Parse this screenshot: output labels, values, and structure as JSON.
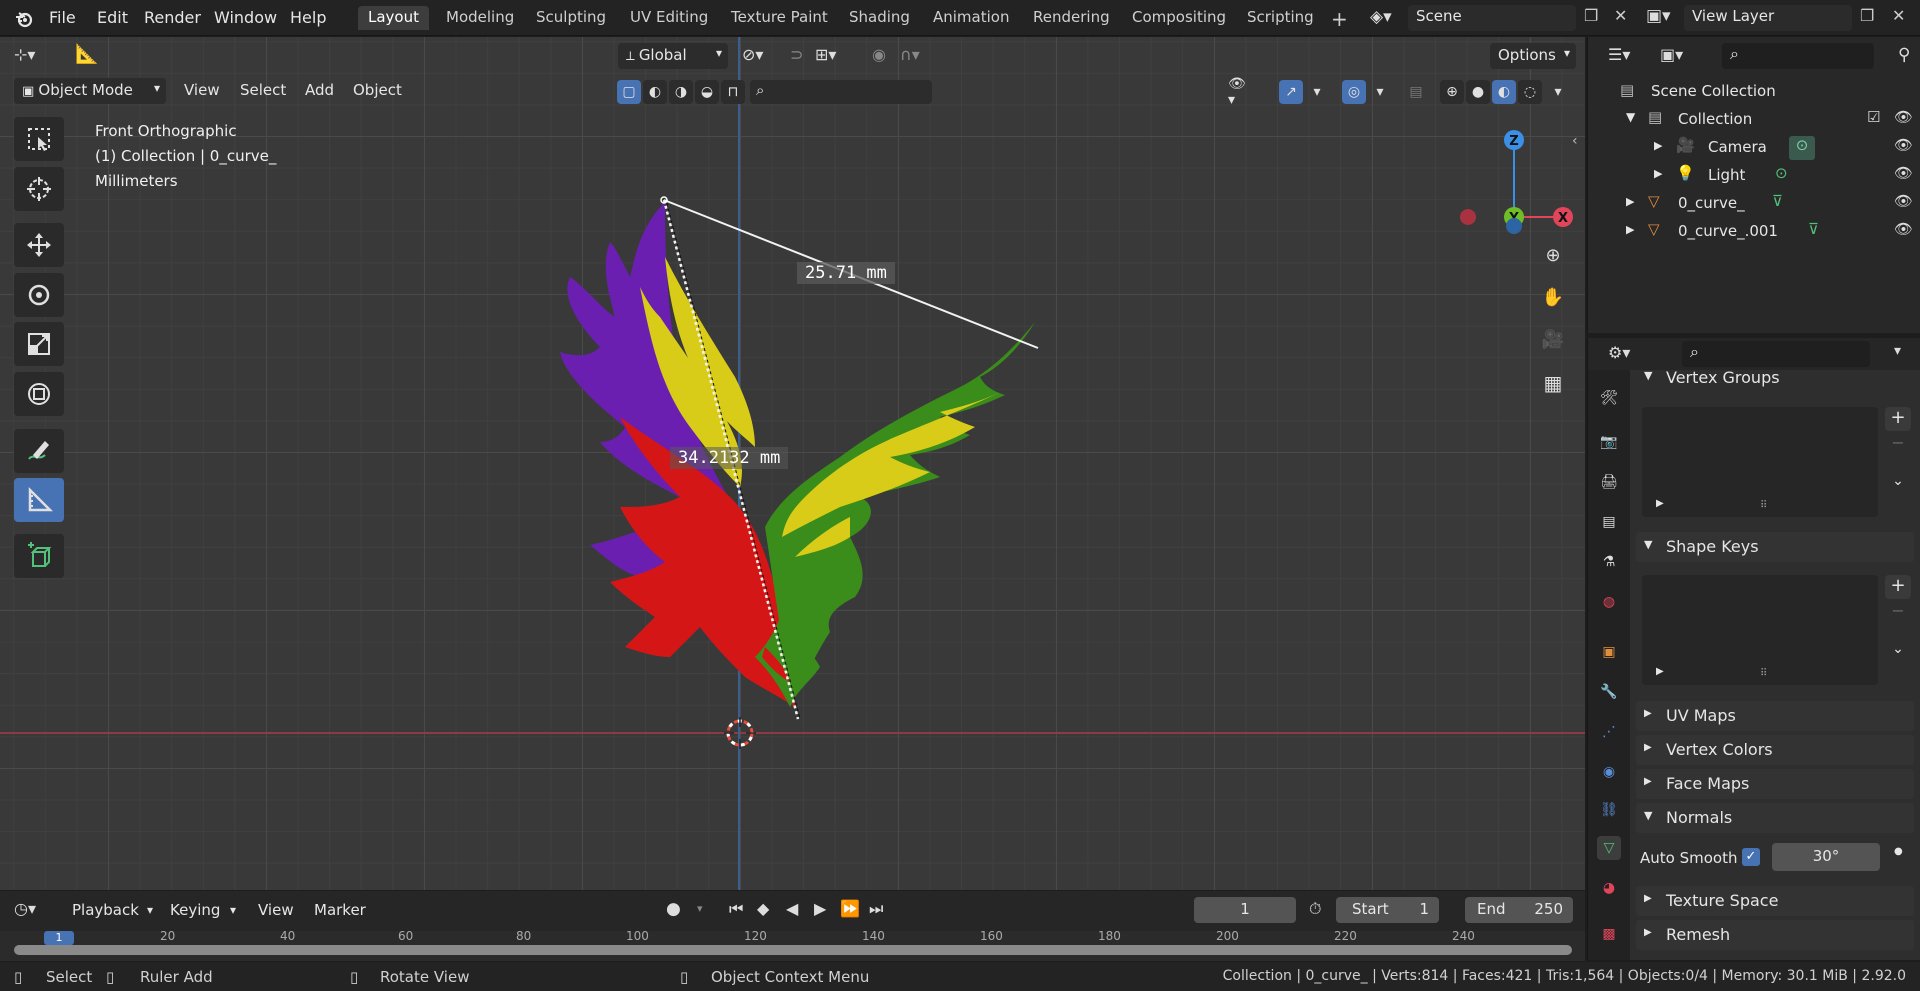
{
  "menubar": {
    "items": [
      "File",
      "Edit",
      "Render",
      "Window",
      "Help"
    ],
    "workspaces": [
      "Layout",
      "Modeling",
      "Sculpting",
      "UV Editing",
      "Texture Paint",
      "Shading",
      "Animation",
      "Rendering",
      "Compositing",
      "Scripting"
    ],
    "active_workspace": "Layout",
    "scene": "Scene",
    "view_layer": "View Layer"
  },
  "viewport_header": {
    "mode": "Object Mode",
    "menus": [
      "View",
      "Select",
      "Add",
      "Object"
    ],
    "orientation": "Global",
    "options": "Options"
  },
  "viewport_overlay": {
    "view_name": "Front Orthographic",
    "collection_info": "(1) Collection | 0_curve_",
    "units": "Millimeters"
  },
  "measurements": {
    "ruler1": "25.71 mm",
    "ruler2": "34.2132 mm"
  },
  "gizmo": {
    "z": "Z",
    "y": "Y",
    "x": "X"
  },
  "outliner": {
    "root": "Scene Collection",
    "items": [
      {
        "label": "Collection",
        "level": 1
      },
      {
        "label": "Camera",
        "level": 2
      },
      {
        "label": "Light",
        "level": 2
      },
      {
        "label": "0_curve_",
        "level": 1
      },
      {
        "label": "0_curve_.001",
        "level": 1
      }
    ]
  },
  "properties": {
    "panels": {
      "vertex_groups": "Vertex Groups",
      "shape_keys": "Shape Keys",
      "uv_maps": "UV Maps",
      "vertex_colors": "Vertex Colors",
      "face_maps": "Face Maps",
      "normals": "Normals",
      "auto_smooth_label": "Auto Smooth",
      "auto_smooth_angle": "30°",
      "texture_space": "Texture Space",
      "remesh": "Remesh"
    }
  },
  "timeline": {
    "menus": [
      "Playback",
      "Keying",
      "View",
      "Marker"
    ],
    "current_frame": "1",
    "start_label": "Start",
    "start": "1",
    "end_label": "End",
    "end": "250",
    "ruler_marks": [
      "20",
      "40",
      "60",
      "80",
      "100",
      "120",
      "140",
      "160",
      "180",
      "200",
      "220",
      "240"
    ],
    "frame_badge": "1"
  },
  "statusbar": {
    "select": "Select",
    "ruler_add": "Ruler Add",
    "rotate_view": "Rotate View",
    "context_menu": "Object Context Menu",
    "stats": "Collection | 0_curve_ | Verts:814 | Faces:421 | Tris:1,564 | Objects:0/4 | Memory: 30.1 MiB | 2.92.0"
  },
  "colors": {
    "accent": "#4772b3",
    "x_axis": "#e0455a",
    "y_axis": "#6ebf26",
    "z_axis": "#3b8fe6",
    "eagle_purple": "#6a1fb0",
    "eagle_yellow": "#d8cc19",
    "eagle_red": "#d51616",
    "eagle_green": "#3a8d1b"
  }
}
